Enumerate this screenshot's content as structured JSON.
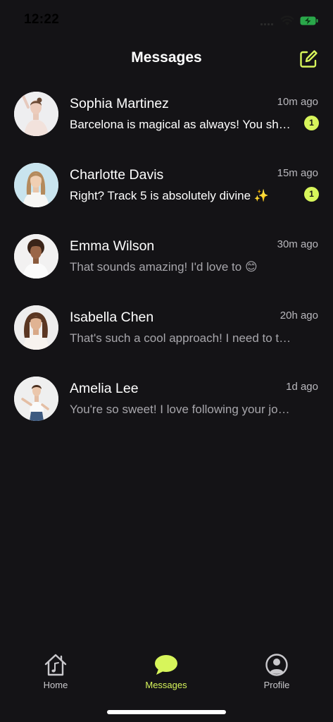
{
  "status_bar": {
    "time": "12:22"
  },
  "header": {
    "title": "Messages",
    "compose_icon": "compose-icon"
  },
  "colors": {
    "background": "#141316",
    "accent": "#d7f55b",
    "primary_text": "#ffffff",
    "secondary_text": "#a7a6ab"
  },
  "conversations": [
    {
      "name": "Sophia Martinez",
      "time": "10m ago",
      "preview": "Barcelona is magical as always! You should come visit",
      "unread": true,
      "unread_count": "1"
    },
    {
      "name": "Charlotte Davis",
      "time": "15m ago",
      "preview": "Right? Track 5 is absolutely divine ✨",
      "unread": true,
      "unread_count": "1"
    },
    {
      "name": "Emma Wilson",
      "time": "30m ago",
      "preview": "That sounds amazing! I'd love to 😊",
      "unread": false
    },
    {
      "name": "Isabella Chen",
      "time": "20h ago",
      "preview": "That's such a cool approach! I need to try that",
      "unread": false
    },
    {
      "name": "Amelia Lee",
      "time": "1d ago",
      "preview": "You're so sweet! I love following your journey",
      "unread": false
    }
  ],
  "tab_bar": {
    "tabs": [
      {
        "label": "Home",
        "icon": "home-music-icon",
        "active": false
      },
      {
        "label": "Messages",
        "icon": "chat-bubble-icon",
        "active": true
      },
      {
        "label": "Profile",
        "icon": "profile-icon",
        "active": false
      }
    ]
  }
}
